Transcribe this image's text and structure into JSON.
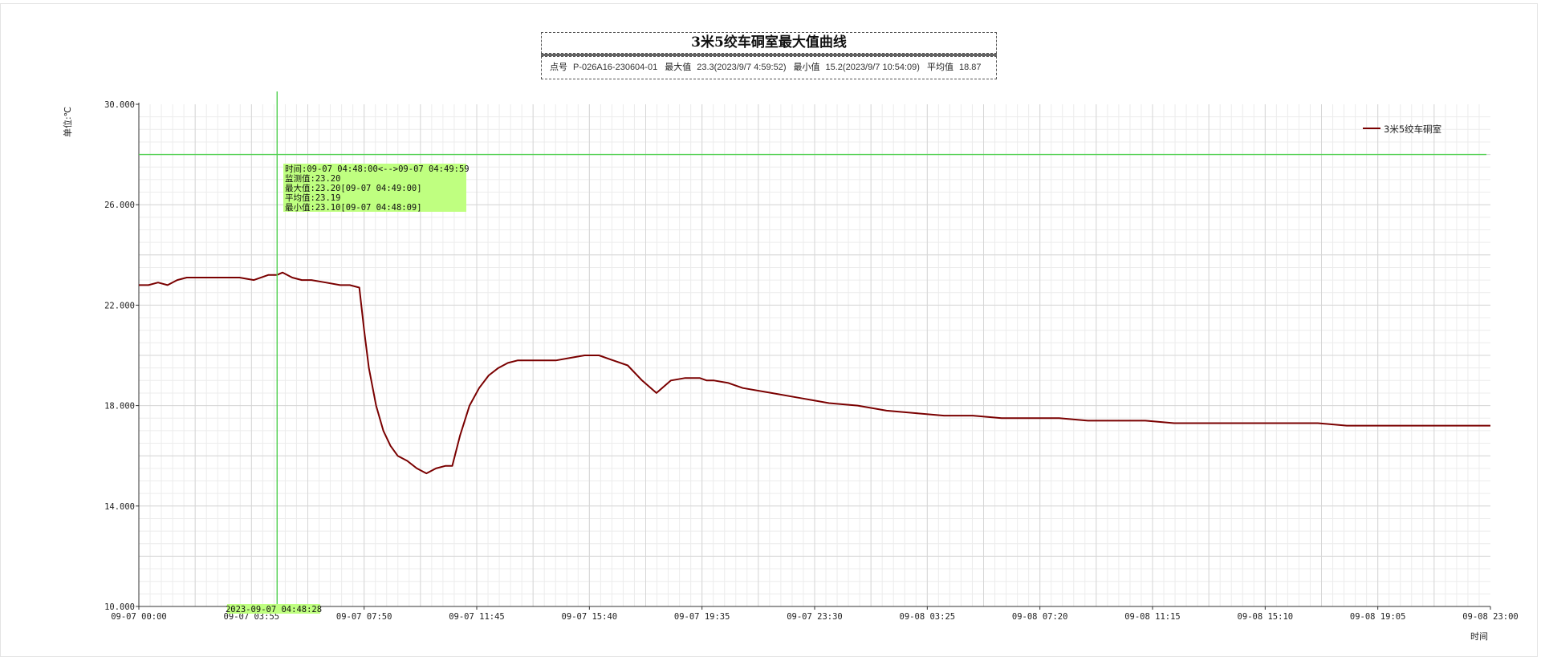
{
  "chart_data": {
    "type": "line",
    "title": "3米5绞车硐室最大值曲线",
    "info": {
      "point_label": "点号",
      "point_value": "P-026A16-230604-01",
      "max_label": "最大值",
      "max_value": "23.3(2023/9/7 4:59:52)",
      "min_label": "最小值",
      "min_value": "15.2(2023/9/7 10:54:09)",
      "avg_label": "平均值",
      "avg_value": "18.87"
    },
    "ylabel": "单位:℃",
    "xlabel": "时间",
    "ylim": [
      10,
      30
    ],
    "yticks": [
      "10.000",
      "14.000",
      "18.000",
      "22.000",
      "26.000",
      "30.000"
    ],
    "xlim": [
      "09-07 00:00",
      "09-08 23:00"
    ],
    "xticks": [
      "09-07 00:00",
      "09-07 03:55",
      "09-07 07:50",
      "09-07 11:45",
      "09-07 15:40",
      "09-07 19:35",
      "09-07 23:30",
      "09-08 03:25",
      "09-08 07:20",
      "09-08 11:15",
      "09-08 15:10",
      "09-08 19:05",
      "09-08 23:00"
    ],
    "grid": true,
    "legend_position": "top-right",
    "threshold_line": {
      "value": 28,
      "color": "#4fd04f"
    },
    "series": [
      {
        "name": "3米5绞车硐室",
        "color": "#7a0000",
        "x": [
          "09-07 00:00",
          "09-07 00:20",
          "09-07 00:40",
          "09-07 01:00",
          "09-07 01:20",
          "09-07 01:40",
          "09-07 02:00",
          "09-07 02:30",
          "09-07 03:00",
          "09-07 03:30",
          "09-07 04:00",
          "09-07 04:30",
          "09-07 04:48",
          "09-07 05:00",
          "09-07 05:20",
          "09-07 05:40",
          "09-07 06:00",
          "09-07 06:30",
          "09-07 07:00",
          "09-07 07:20",
          "09-07 07:40",
          "09-07 07:50",
          "09-07 08:00",
          "09-07 08:15",
          "09-07 08:30",
          "09-07 08:45",
          "09-07 09:00",
          "09-07 09:20",
          "09-07 09:40",
          "09-07 10:00",
          "09-07 10:20",
          "09-07 10:40",
          "09-07 10:54",
          "09-07 11:10",
          "09-07 11:30",
          "09-07 11:50",
          "09-07 12:10",
          "09-07 12:30",
          "09-07 12:50",
          "09-07 13:10",
          "09-07 13:30",
          "09-07 13:50",
          "09-07 14:10",
          "09-07 14:30",
          "09-07 15:00",
          "09-07 15:30",
          "09-07 16:00",
          "09-07 16:30",
          "09-07 17:00",
          "09-07 17:30",
          "09-07 18:00",
          "09-07 18:30",
          "09-07 19:00",
          "09-07 19:30",
          "09-07 19:45",
          "09-07 20:00",
          "09-07 20:30",
          "09-07 21:00",
          "09-07 22:00",
          "09-07 23:00",
          "09-08 00:00",
          "09-08 01:00",
          "09-08 02:00",
          "09-08 03:00",
          "09-08 04:00",
          "09-08 05:00",
          "09-08 06:00",
          "09-08 07:00",
          "09-08 08:00",
          "09-08 09:00",
          "09-08 10:00",
          "09-08 11:00",
          "09-08 12:00",
          "09-08 13:00",
          "09-08 14:00",
          "09-08 15:00",
          "09-08 16:00",
          "09-08 17:00",
          "09-08 18:00",
          "09-08 19:00",
          "09-08 20:00",
          "09-08 21:00",
          "09-08 22:00",
          "09-08 23:00"
        ],
        "values": [
          22.8,
          22.8,
          22.9,
          22.8,
          23.0,
          23.1,
          23.1,
          23.1,
          23.1,
          23.1,
          23.0,
          23.2,
          23.2,
          23.3,
          23.1,
          23.0,
          23.0,
          22.9,
          22.8,
          22.8,
          22.7,
          21.0,
          19.5,
          18.0,
          17.0,
          16.4,
          16.0,
          15.8,
          15.5,
          15.3,
          15.5,
          15.6,
          15.6,
          16.8,
          18.0,
          18.7,
          19.2,
          19.5,
          19.7,
          19.8,
          19.8,
          19.8,
          19.8,
          19.8,
          19.9,
          20.0,
          20.0,
          19.8,
          19.6,
          19.0,
          18.5,
          19.0,
          19.1,
          19.1,
          19.0,
          19.0,
          18.9,
          18.7,
          18.5,
          18.3,
          18.1,
          18.0,
          17.8,
          17.7,
          17.6,
          17.6,
          17.5,
          17.5,
          17.5,
          17.4,
          17.4,
          17.4,
          17.3,
          17.3,
          17.3,
          17.3,
          17.3,
          17.3,
          17.2,
          17.2,
          17.2,
          17.2,
          17.2,
          17.2
        ]
      }
    ],
    "cursor": {
      "tag": "2023-09-07 04:48:28",
      "tooltip": [
        "时间:09-07 04:48:00<-->09-07 04:49:59",
        "监测值:23.20",
        "最大值:23.20[09-07 04:49:00]",
        "平均值:23.19",
        "最小值:23.10[09-07 04:48:09]"
      ]
    }
  }
}
